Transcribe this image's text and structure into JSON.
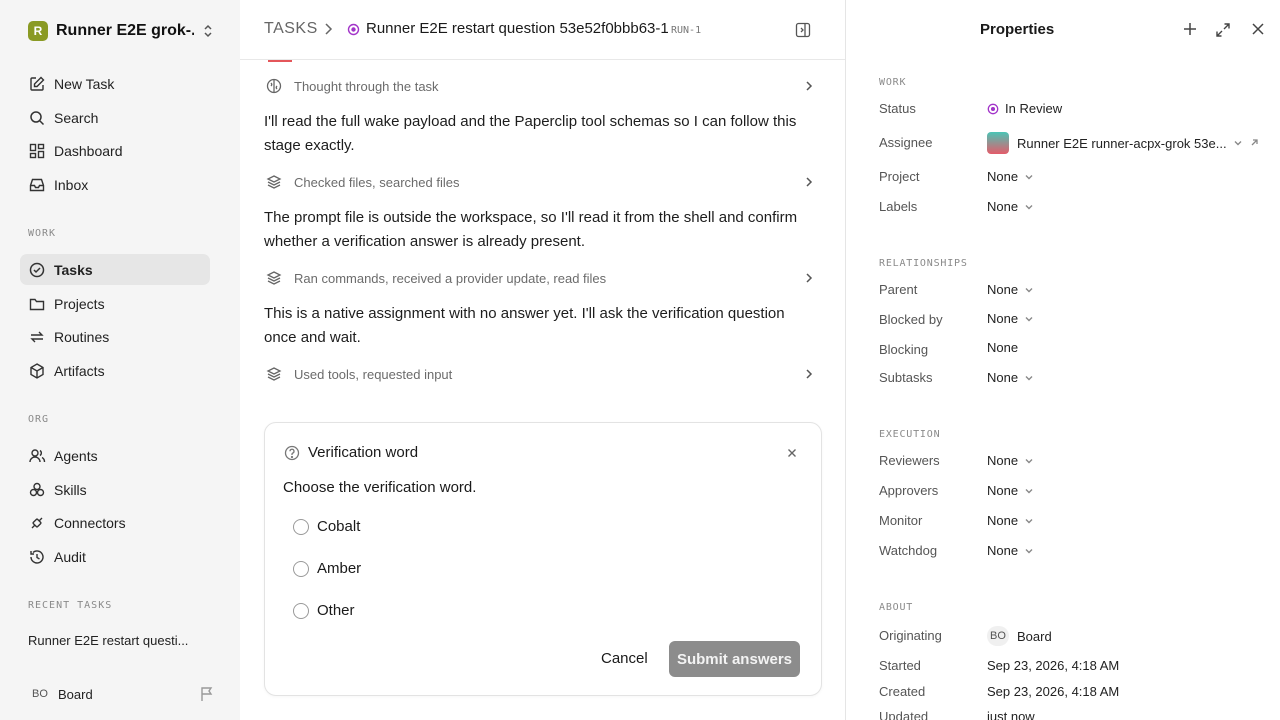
{
  "sidebar": {
    "workspace_initial": "R",
    "workspace_name": "Runner E2E grok-...",
    "nav_top": [
      {
        "label": "New Task",
        "icon": "new-task-icon"
      },
      {
        "label": "Search",
        "icon": "search-icon"
      },
      {
        "label": "Dashboard",
        "icon": "dashboard-icon"
      },
      {
        "label": "Inbox",
        "icon": "inbox-icon"
      }
    ],
    "work_title": "WORK",
    "nav_work": [
      {
        "label": "Tasks",
        "icon": "tasks-icon",
        "active": true
      },
      {
        "label": "Projects",
        "icon": "folder-icon"
      },
      {
        "label": "Routines",
        "icon": "routines-icon"
      },
      {
        "label": "Artifacts",
        "icon": "artifacts-icon"
      }
    ],
    "org_title": "ORG",
    "nav_org": [
      {
        "label": "Agents",
        "icon": "agents-icon"
      },
      {
        "label": "Skills",
        "icon": "skills-icon"
      },
      {
        "label": "Connectors",
        "icon": "connectors-icon"
      },
      {
        "label": "Audit",
        "icon": "audit-icon"
      }
    ],
    "recent_title": "RECENT TASKS",
    "recent_item": "Runner E2E restart questi...",
    "footer_initials": "BO",
    "footer_label": "Board"
  },
  "header": {
    "tasks_crumb": "TASKS",
    "title": "Runner E2E restart question 53e52f0bbb63-1",
    "run_id": "RUN-1"
  },
  "transcript": {
    "step1": "Thought through the task",
    "para1": "I'll read the full wake payload and the Paperclip tool schemas so I can follow this stage exactly.",
    "step2": "Checked files, searched files",
    "para2": "The prompt file is outside the workspace, so I'll read it from the shell and confirm whether a verification answer is already present.",
    "step3": "Ran commands, received a provider update, read files",
    "para3": "This is a native assignment with no answer yet. I'll ask the verification question once and wait.",
    "step4": "Used tools, requested input"
  },
  "question": {
    "title": "Verification word",
    "prompt": "Choose the verification word.",
    "options": [
      "Cobalt",
      "Amber",
      "Other"
    ],
    "cancel_label": "Cancel",
    "submit_label": "Submit answers"
  },
  "properties": {
    "title": "Properties",
    "work_section": "WORK",
    "status_label": "Status",
    "status_value": "In Review",
    "assignee_label": "Assignee",
    "assignee_value": "Runner E2E runner-acpx-grok 53e...",
    "project_label": "Project",
    "project_value": "None",
    "labels_label": "Labels",
    "labels_value": "None",
    "rel_section": "RELATIONSHIPS",
    "parent_label": "Parent",
    "parent_value": "None",
    "blocked_label": "Blocked by",
    "blocked_value": "None",
    "blocking_label": "Blocking",
    "blocking_value": "None",
    "subtasks_label": "Subtasks",
    "subtasks_value": "None",
    "exec_section": "EXECUTION",
    "reviewers_label": "Reviewers",
    "reviewers_value": "None",
    "approvers_label": "Approvers",
    "approvers_value": "None",
    "monitor_label": "Monitor",
    "monitor_value": "None",
    "watchdog_label": "Watchdog",
    "watchdog_value": "None",
    "about_section": "ABOUT",
    "orig_label": "Originating",
    "orig_initials": "BO",
    "orig_value": "Board",
    "started_label": "Started",
    "started_value": "Sep 23, 2026, 4:18 AM",
    "created_label": "Created",
    "created_value": "Sep 23, 2026, 4:18 AM",
    "updated_label": "Updated",
    "updated_value": "just now"
  },
  "colors": {
    "accent_status": "#a234c9",
    "submit_bg": "#8c8c8c",
    "sidebar_bg": "#f5f5f5",
    "active_bg": "#e6e6e6"
  }
}
